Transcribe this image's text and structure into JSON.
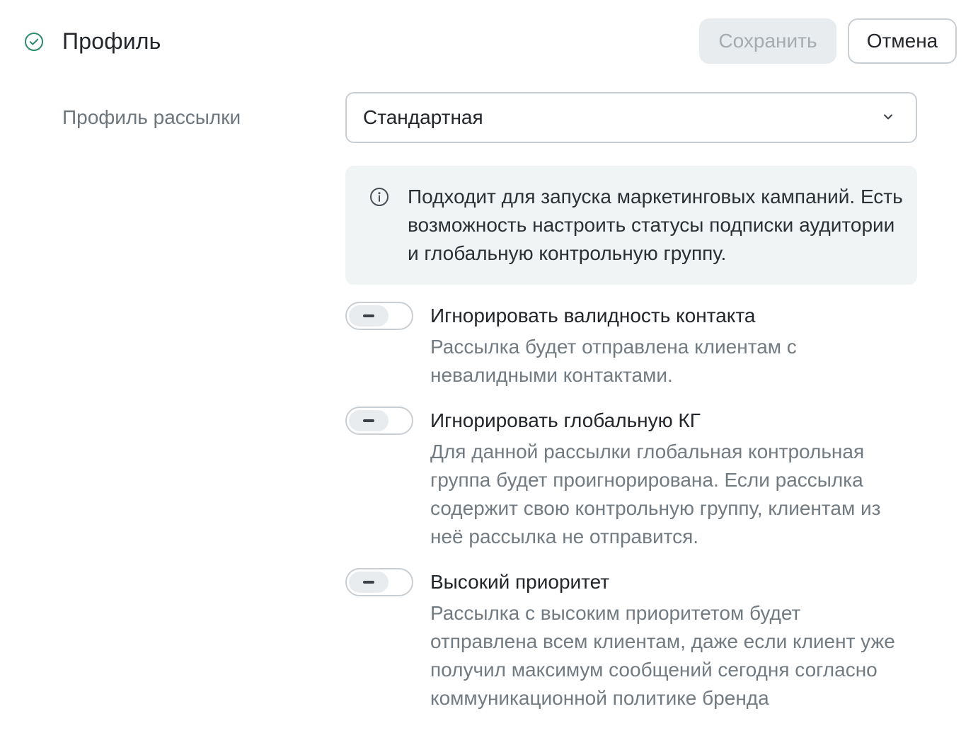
{
  "header": {
    "title": "Профиль",
    "status_icon": "check-circle-icon",
    "save_label": "Сохранить",
    "cancel_label": "Отмена"
  },
  "field": {
    "label": "Профиль рассылки",
    "selected_value": "Стандартная"
  },
  "info": {
    "icon": "info-icon",
    "text": "Подходит для запуска маркетинговых кампаний. Есть возможность настроить статусы подписки аудитории и глобальную контрольную группу."
  },
  "toggles": [
    {
      "title": "Игнорировать валидность контакта",
      "description": "Рассылка будет отправлена клиентам с невалидными контактами."
    },
    {
      "title": "Игнорировать глобальную КГ",
      "description": "Для данной рассылки глобальная контрольная группа будет проигнорирована. Если рассылка содержит свою контрольную группу, клиентам из неё рассылка не отправится."
    },
    {
      "title": "Высокий приоритет",
      "description": "Рассылка с высоким приоритетом будет отправлена всем клиентам, даже если клиент уже получил максимум сообщений сегодня согласно коммуникационной политике бренда"
    }
  ],
  "colors": {
    "accent": "#2e8a6c",
    "muted_text": "#737b82",
    "border": "#c9ced3",
    "info_bg": "#f1f4f5"
  }
}
